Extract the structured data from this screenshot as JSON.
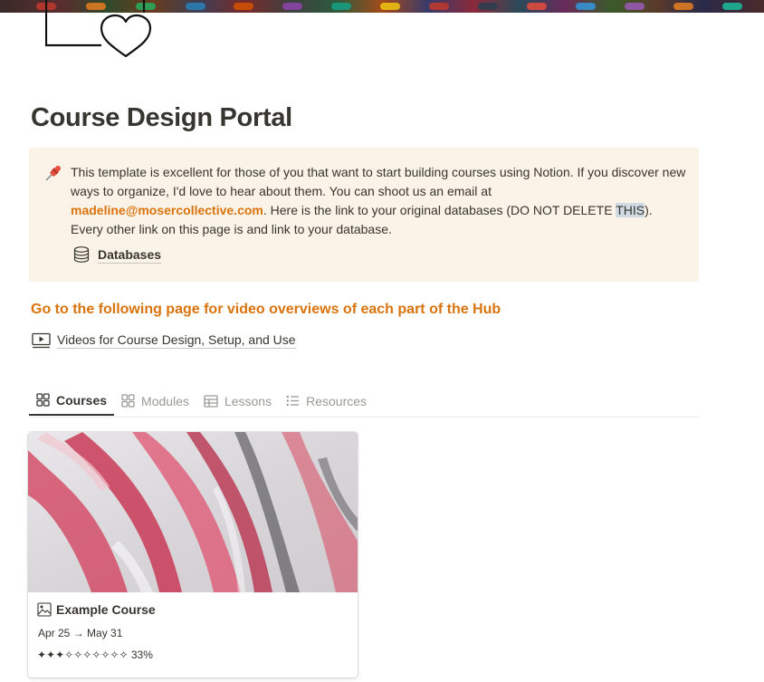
{
  "page": {
    "title": "Course Design Portal",
    "icon": "laptop-heart-icon"
  },
  "callout": {
    "icon": "pushpin-icon",
    "text_part1": "This template is excellent for those of you that want to start building courses using Notion. If you discover new ways to organize, I'd love to hear about them. You can shoot us an email at ",
    "email": "madeline@mosercollective.com",
    "text_part2": ".  Here is the link to your original databases (DO NOT DELETE ",
    "highlight": "THIS",
    "text_part3": "). Every other link on this page is and link to your database.",
    "link_icon": "database-icon",
    "link_label": "Databases"
  },
  "video_section": {
    "heading": "Go to the following page for video overviews of each part of the Hub",
    "link_icon": "video-icon",
    "link_label": "Videos for Course Design, Setup, and Use"
  },
  "tabs": [
    {
      "label": "Courses",
      "icon": "gallery-icon",
      "active": true
    },
    {
      "label": "Modules",
      "icon": "gallery-icon",
      "active": false
    },
    {
      "label": "Lessons",
      "icon": "table-icon",
      "active": false
    },
    {
      "label": "Resources",
      "icon": "list-icon",
      "active": false
    }
  ],
  "gallery": {
    "cards": [
      {
        "title": "Example Course",
        "icon": "image-icon",
        "dates": "Apr 25 → May 31",
        "progress": "✦✦✦✧✧✧✧✧✧✧ 33%"
      }
    ]
  },
  "colors": {
    "accent_orange": "#d9730d",
    "callout_bg": "#fbf3e7",
    "text": "#37352f",
    "muted": "#9b9a97"
  }
}
